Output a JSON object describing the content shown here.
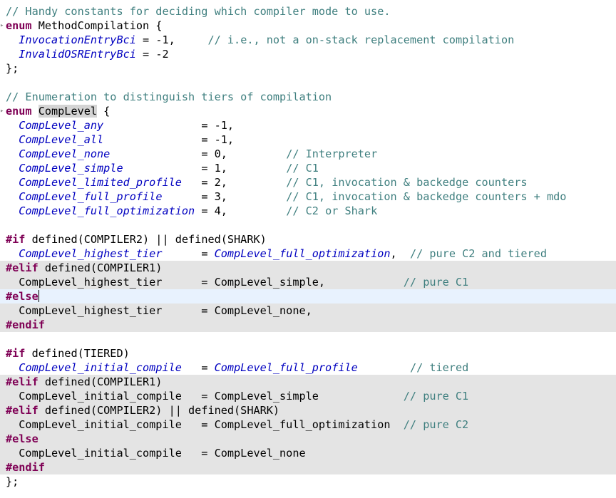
{
  "editor": {
    "colors": {
      "comment": "#3f7f7f",
      "keyword": "#7f0055",
      "enum_constant": "#0000c0",
      "inactive_block_bg": "#e4e4e4",
      "current_line_bg": "#e8f2fe",
      "occurrence_highlight_bg": "#d4d4d4"
    },
    "lines": [
      {
        "state": "normal",
        "segs": [
          {
            "t": "// Handy constants for deciding which compiler mode to use.",
            "c": "comment"
          }
        ]
      },
      {
        "state": "normal",
        "fold": true,
        "segs": [
          {
            "t": "enum",
            "c": "keyword"
          },
          {
            "t": " MethodCompilation {",
            "c": "plain"
          }
        ]
      },
      {
        "state": "normal",
        "segs": [
          {
            "t": "  ",
            "c": "plain"
          },
          {
            "t": "InvocationEntryBci",
            "c": "enumconst"
          },
          {
            "t": " = -1,     ",
            "c": "plain"
          },
          {
            "t": "// i.e., not a on-stack replacement compilation",
            "c": "comment"
          }
        ]
      },
      {
        "state": "normal",
        "segs": [
          {
            "t": "  ",
            "c": "plain"
          },
          {
            "t": "InvalidOSREntryBci",
            "c": "enumconst"
          },
          {
            "t": " = -2",
            "c": "plain"
          }
        ]
      },
      {
        "state": "normal",
        "segs": [
          {
            "t": "};",
            "c": "plain"
          }
        ]
      },
      {
        "state": "normal",
        "segs": [
          {
            "t": "",
            "c": "plain"
          }
        ]
      },
      {
        "state": "normal",
        "segs": [
          {
            "t": "// Enumeration to distinguish tiers of compilation",
            "c": "comment"
          }
        ]
      },
      {
        "state": "normal",
        "fold": true,
        "segs": [
          {
            "t": "enum",
            "c": "keyword"
          },
          {
            "t": " ",
            "c": "plain"
          },
          {
            "t": "CompLevel",
            "c": "plain",
            "hl": true
          },
          {
            "t": " {",
            "c": "plain"
          }
        ]
      },
      {
        "state": "normal",
        "segs": [
          {
            "t": "  ",
            "c": "plain"
          },
          {
            "t": "CompLevel_any",
            "c": "enumconst"
          },
          {
            "t": "               = -1,",
            "c": "plain"
          }
        ]
      },
      {
        "state": "normal",
        "segs": [
          {
            "t": "  ",
            "c": "plain"
          },
          {
            "t": "CompLevel_all",
            "c": "enumconst"
          },
          {
            "t": "               = -1,",
            "c": "plain"
          }
        ]
      },
      {
        "state": "normal",
        "segs": [
          {
            "t": "  ",
            "c": "plain"
          },
          {
            "t": "CompLevel_none",
            "c": "enumconst"
          },
          {
            "t": "              = 0,         ",
            "c": "plain"
          },
          {
            "t": "// Interpreter",
            "c": "comment"
          }
        ]
      },
      {
        "state": "normal",
        "segs": [
          {
            "t": "  ",
            "c": "plain"
          },
          {
            "t": "CompLevel_simple",
            "c": "enumconst"
          },
          {
            "t": "            = 1,         ",
            "c": "plain"
          },
          {
            "t": "// C1",
            "c": "comment"
          }
        ]
      },
      {
        "state": "normal",
        "segs": [
          {
            "t": "  ",
            "c": "plain"
          },
          {
            "t": "CompLevel_limited_profile",
            "c": "enumconst"
          },
          {
            "t": "   = 2,         ",
            "c": "plain"
          },
          {
            "t": "// C1, invocation & backedge counters",
            "c": "comment"
          }
        ]
      },
      {
        "state": "normal",
        "segs": [
          {
            "t": "  ",
            "c": "plain"
          },
          {
            "t": "CompLevel_full_profile",
            "c": "enumconst"
          },
          {
            "t": "      = 3,         ",
            "c": "plain"
          },
          {
            "t": "// C1, invocation & backedge counters + mdo",
            "c": "comment"
          }
        ]
      },
      {
        "state": "normal",
        "segs": [
          {
            "t": "  ",
            "c": "plain"
          },
          {
            "t": "CompLevel_full_optimization",
            "c": "enumconst"
          },
          {
            "t": " = 4,         ",
            "c": "plain"
          },
          {
            "t": "// C2 or Shark",
            "c": "comment"
          }
        ]
      },
      {
        "state": "normal",
        "segs": [
          {
            "t": "",
            "c": "plain"
          }
        ]
      },
      {
        "state": "normal",
        "segs": [
          {
            "t": "#if",
            "c": "keyword"
          },
          {
            "t": " defined(COMPILER2) || defined(SHARK)",
            "c": "plain"
          }
        ]
      },
      {
        "state": "normal",
        "segs": [
          {
            "t": "  ",
            "c": "plain"
          },
          {
            "t": "CompLevel_highest_tier",
            "c": "enumconst"
          },
          {
            "t": "      = ",
            "c": "plain"
          },
          {
            "t": "CompLevel_full_optimization",
            "c": "enumconst"
          },
          {
            "t": ",  ",
            "c": "plain"
          },
          {
            "t": "// pure C2 and tiered",
            "c": "comment"
          }
        ]
      },
      {
        "state": "inactive",
        "segs": [
          {
            "t": "#elif",
            "c": "keyword"
          },
          {
            "t": " defined(COMPILER1)",
            "c": "plain"
          }
        ]
      },
      {
        "state": "inactive",
        "segs": [
          {
            "t": "  CompLevel_highest_tier      = CompLevel_simple,            ",
            "c": "plain"
          },
          {
            "t": "// pure C1",
            "c": "comment"
          }
        ]
      },
      {
        "state": "current",
        "caret": true,
        "segs": [
          {
            "t": "#else",
            "c": "keyword"
          }
        ]
      },
      {
        "state": "inactive",
        "segs": [
          {
            "t": "  CompLevel_highest_tier      = CompLevel_none,",
            "c": "plain"
          }
        ]
      },
      {
        "state": "inactive",
        "segs": [
          {
            "t": "#endif",
            "c": "keyword"
          }
        ]
      },
      {
        "state": "normal",
        "segs": [
          {
            "t": "",
            "c": "plain"
          }
        ]
      },
      {
        "state": "normal",
        "segs": [
          {
            "t": "#if",
            "c": "keyword"
          },
          {
            "t": " defined(TIERED)",
            "c": "plain"
          }
        ]
      },
      {
        "state": "normal",
        "segs": [
          {
            "t": "  ",
            "c": "plain"
          },
          {
            "t": "CompLevel_initial_compile",
            "c": "enumconst"
          },
          {
            "t": "   = ",
            "c": "plain"
          },
          {
            "t": "CompLevel_full_profile",
            "c": "enumconst"
          },
          {
            "t": "        ",
            "c": "plain"
          },
          {
            "t": "// tiered",
            "c": "comment"
          }
        ]
      },
      {
        "state": "inactive",
        "segs": [
          {
            "t": "#elif",
            "c": "keyword"
          },
          {
            "t": " defined(COMPILER1)",
            "c": "plain"
          }
        ]
      },
      {
        "state": "inactive",
        "segs": [
          {
            "t": "  CompLevel_initial_compile   = CompLevel_simple             ",
            "c": "plain"
          },
          {
            "t": "// pure C1",
            "c": "comment"
          }
        ]
      },
      {
        "state": "inactive",
        "segs": [
          {
            "t": "#elif",
            "c": "keyword"
          },
          {
            "t": " defined(COMPILER2) || defined(SHARK)",
            "c": "plain"
          }
        ]
      },
      {
        "state": "inactive",
        "segs": [
          {
            "t": "  CompLevel_initial_compile   = CompLevel_full_optimization  ",
            "c": "plain"
          },
          {
            "t": "// pure C2",
            "c": "comment"
          }
        ]
      },
      {
        "state": "inactive",
        "segs": [
          {
            "t": "#else",
            "c": "keyword"
          }
        ]
      },
      {
        "state": "inactive",
        "segs": [
          {
            "t": "  CompLevel_initial_compile   = CompLevel_none",
            "c": "plain"
          }
        ]
      },
      {
        "state": "inactive",
        "segs": [
          {
            "t": "#endif",
            "c": "keyword"
          }
        ]
      },
      {
        "state": "normal",
        "segs": [
          {
            "t": "};",
            "c": "plain"
          }
        ]
      }
    ]
  }
}
